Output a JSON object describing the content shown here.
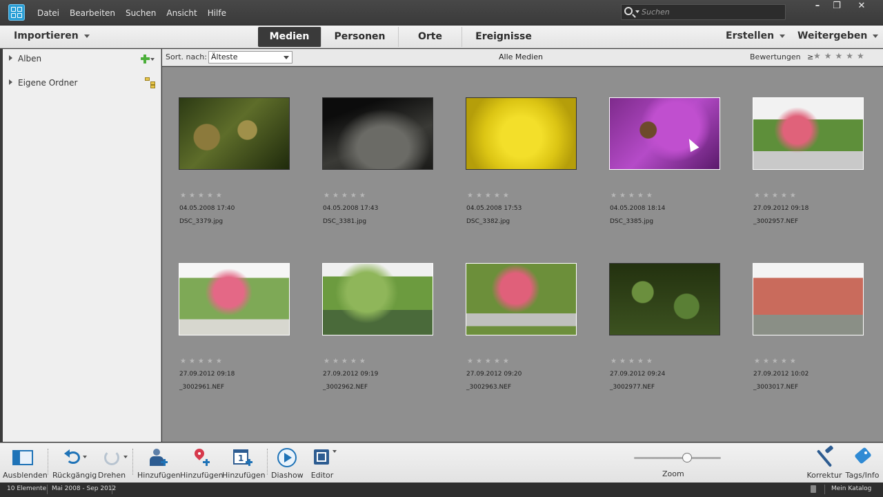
{
  "menu": [
    "Datei",
    "Bearbeiten",
    "Suchen",
    "Ansicht",
    "Hilfe"
  ],
  "search": {
    "placeholder": "Suchen"
  },
  "window_controls": {
    "minimize": "–",
    "restore": "❐",
    "close": "✕"
  },
  "modebar": {
    "import_label": "Importieren",
    "tabs": [
      "Medien",
      "Personen",
      "Orte",
      "Ereignisse"
    ],
    "active_tab": "Medien",
    "create_label": "Erstellen",
    "share_label": "Weitergeben"
  },
  "sidebar": {
    "albums_label": "Alben",
    "folders_label": "Eigene Ordner"
  },
  "filterbar": {
    "sort_label": "Sort. nach:",
    "sort_value": "Älteste",
    "center_label": "Alle Medien",
    "rating_label": "Bewertungen",
    "rating_op": "≥",
    "rating_stars": "★★★★★"
  },
  "media": [
    {
      "date": "04.05.2008 17:40",
      "file": "DSC_3379.jpg",
      "stars": "★★★★★",
      "thumb": "fern"
    },
    {
      "date": "04.05.2008 17:43",
      "file": "DSC_3381.jpg",
      "stars": "★★★★★",
      "thumb": "stone"
    },
    {
      "date": "04.05.2008 17:53",
      "file": "DSC_3382.jpg",
      "stars": "★★★★★",
      "thumb": "dandelion"
    },
    {
      "date": "04.05.2008 18:14",
      "file": "DSC_3385.jpg",
      "stars": "★★★★★",
      "thumb": "bee-flower"
    },
    {
      "date": "27.09.2012 09:18",
      "file": "_3002957.NEF",
      "stars": "★★★★★",
      "thumb": "park-tree"
    },
    {
      "date": "27.09.2012 09:18",
      "file": "_3002961.NEF",
      "stars": "★★★★★",
      "thumb": "pink-tree"
    },
    {
      "date": "27.09.2012 09:19",
      "file": "_3002962.NEF",
      "stars": "★★★★★",
      "thumb": "willow-pond"
    },
    {
      "date": "27.09.2012 09:20",
      "file": "_3002963.NEF",
      "stars": "★★★★★",
      "thumb": "tree-fence"
    },
    {
      "date": "27.09.2012 09:24",
      "file": "_3002977.NEF",
      "stars": "★★★★★",
      "thumb": "lily-pads"
    },
    {
      "date": "27.09.2012 10:02",
      "file": "_3003017.NEF",
      "stars": "★★★★★",
      "thumb": "town-hall"
    }
  ],
  "toolbar": {
    "hide": "Ausblenden",
    "undo": "Rückgängig",
    "rotate": "Drehen",
    "add_person": "Hinzufügen",
    "add_place": "Hinzufügen",
    "add_event": "Hinzufügen",
    "slideshow": "Diashow",
    "editor": "Editor",
    "zoom": "Zoom",
    "fix": "Korrektur",
    "tags": "Tags/Info"
  },
  "statusbar": {
    "count": "10 Elemente",
    "range": "Mai 2008 - Sep 2012",
    "catalog": "Mein Katalog"
  },
  "colors": {
    "accent": "#2a9fd6",
    "grid_bg": "#8f8f8f",
    "active_tab": "#3a3a3a"
  }
}
